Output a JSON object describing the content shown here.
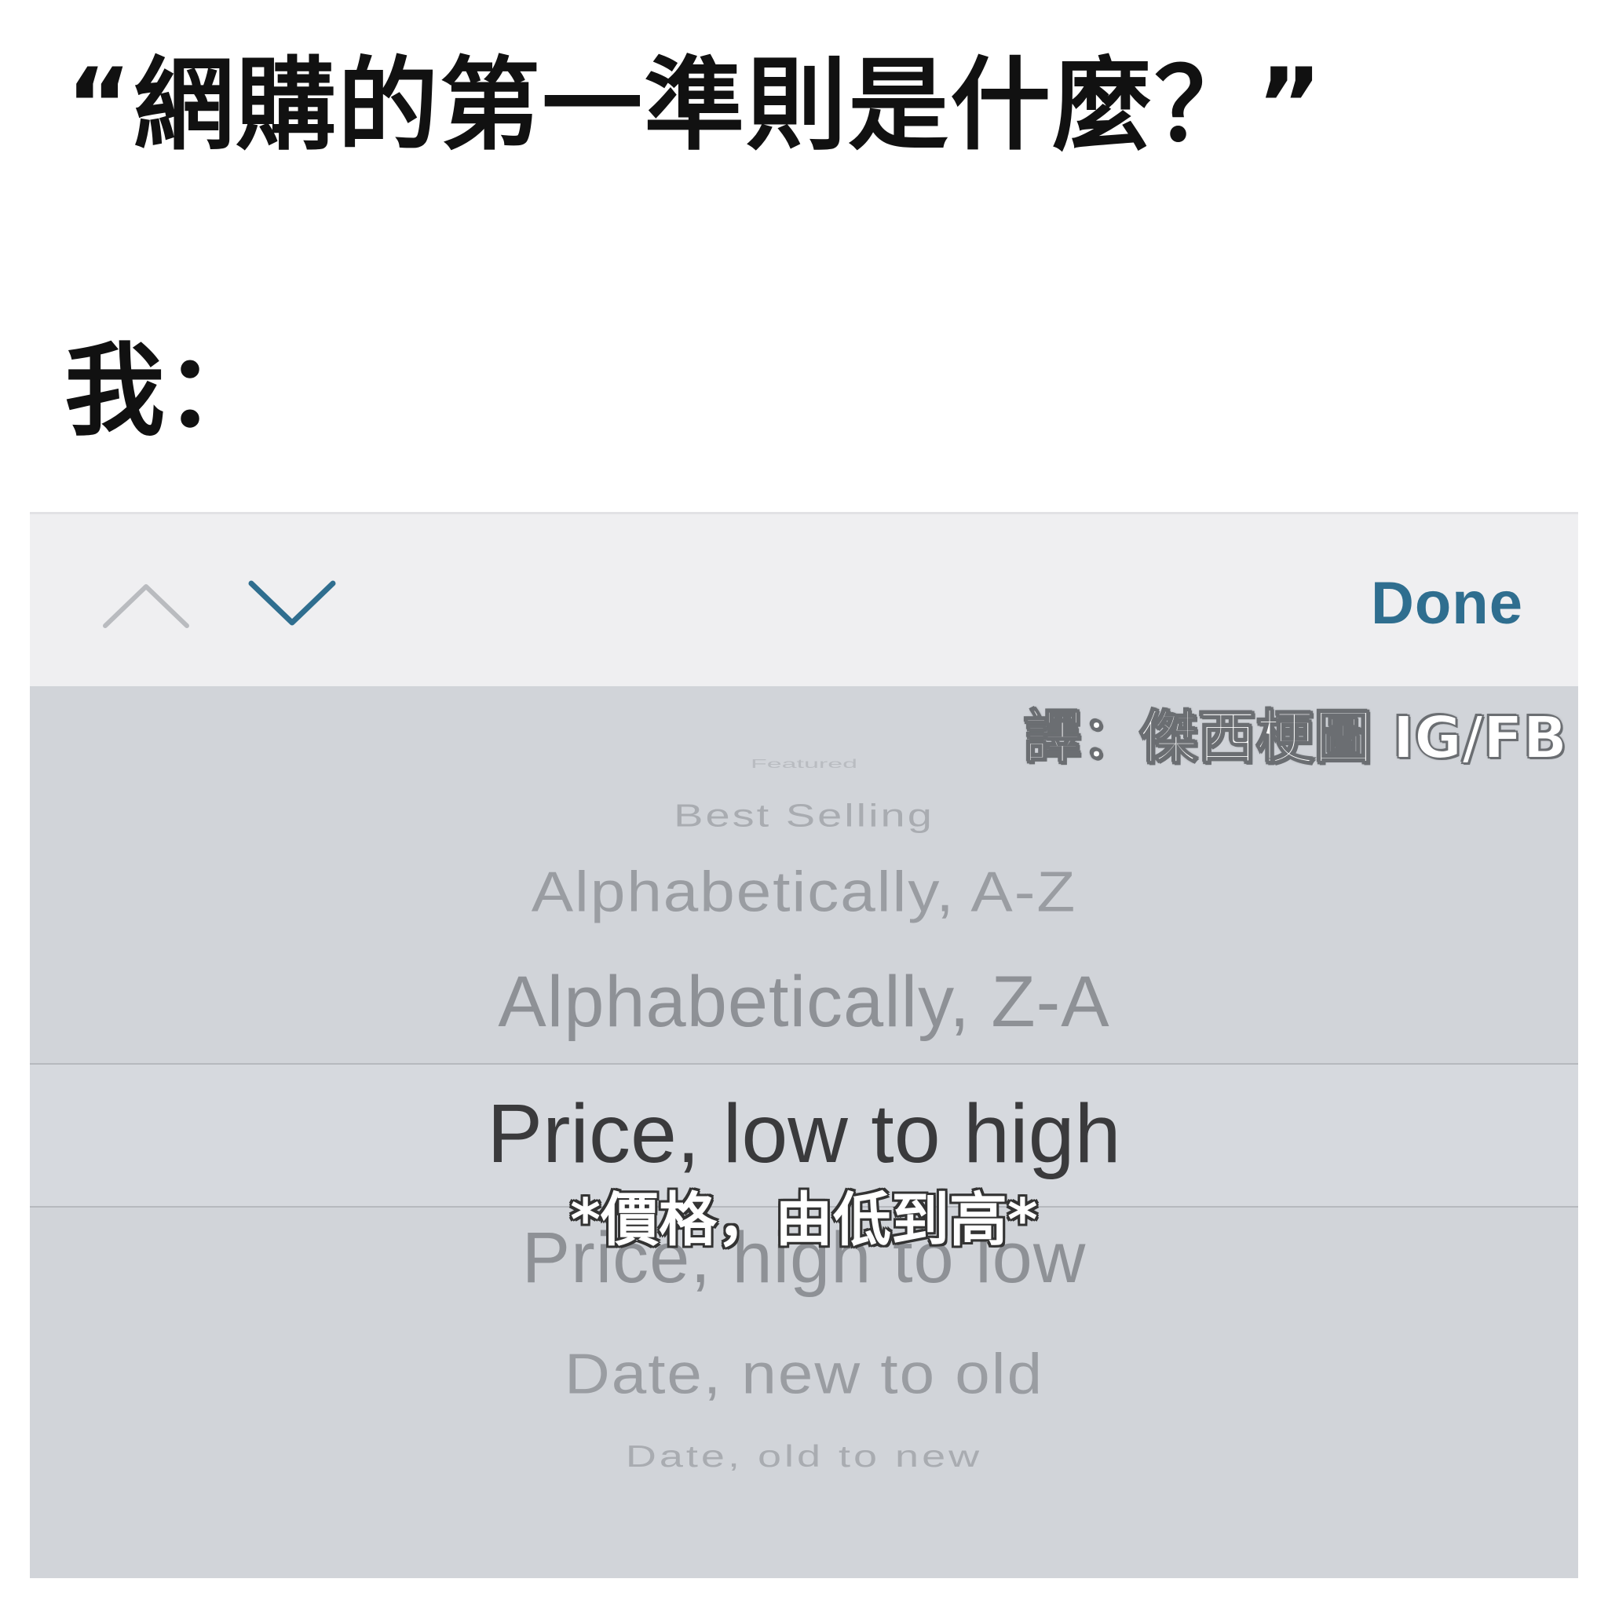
{
  "caption": "“網購的第一準則是什麼？”",
  "reply": "我：",
  "toolbar": {
    "up_icon": "chevron-up-icon",
    "down_icon": "chevron-down-icon",
    "done_label": "Done",
    "done_color": "#2f6e8f"
  },
  "watermark": "譯：傑西梗圖 IG/FB",
  "sort_picker": {
    "options": [
      "Featured",
      "Best Selling",
      "Alphabetically, A-Z",
      "Alphabetically, Z-A",
      "Price, low to high",
      "Price, high to low",
      "Date, new to old",
      "Date, old to new"
    ],
    "selected": "Price, low to high"
  },
  "subtitle": "*價格，由低到高*"
}
